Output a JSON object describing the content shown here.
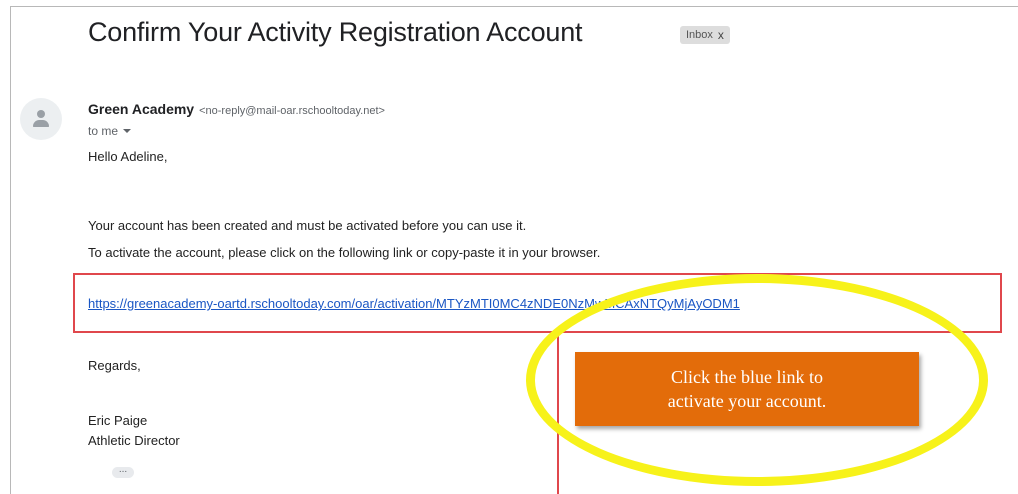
{
  "email": {
    "subject": "Confirm Your Activity Registration Account",
    "label_chip": "Inbox",
    "label_close": "x",
    "sender_name": "Green Academy",
    "sender_email": "<no-reply@mail-oar.rschooltoday.net>",
    "recipient": "to me",
    "greeting": "Hello Adeline,",
    "body_line1": "Your account has been created and must be activated before you can use it.",
    "body_line2": "To activate the account, please click on the following link or copy-paste it in your browser.",
    "activation_link": "https://greenacademy-oartd.rschooltoday.com/oar/activation/MTYzMTI0MC4zNDE0NzMwMCAxNTQyMjAyODM1",
    "closing": "Regards,",
    "signer_name": "Eric Paige",
    "signer_title": "Athletic Director",
    "trimmed_content": "..."
  },
  "annotation": {
    "callout_line1": "Click the blue link to",
    "callout_line2": "activate  your account.",
    "callout_color": "#e36c0a",
    "highlight_color": "#f7f21a",
    "box_color": "#e0474c"
  }
}
